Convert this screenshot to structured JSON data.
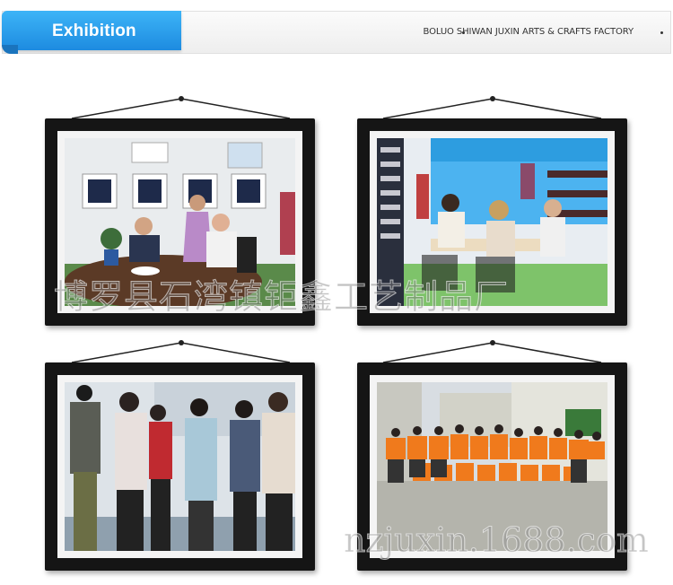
{
  "header": {
    "title": "Exhibition",
    "company": "BOLUO SHIWAN JUXIN ARTS & CRAFTS FACTORY"
  },
  "watermarks": {
    "chinese": "博罗县石湾镇钜鑫工艺制品厂",
    "site": "nzjuxin.1688.com"
  },
  "colors": {
    "accent": "#1d8be0",
    "frame": "#151515",
    "team_shirt": "#f07a1c"
  }
}
